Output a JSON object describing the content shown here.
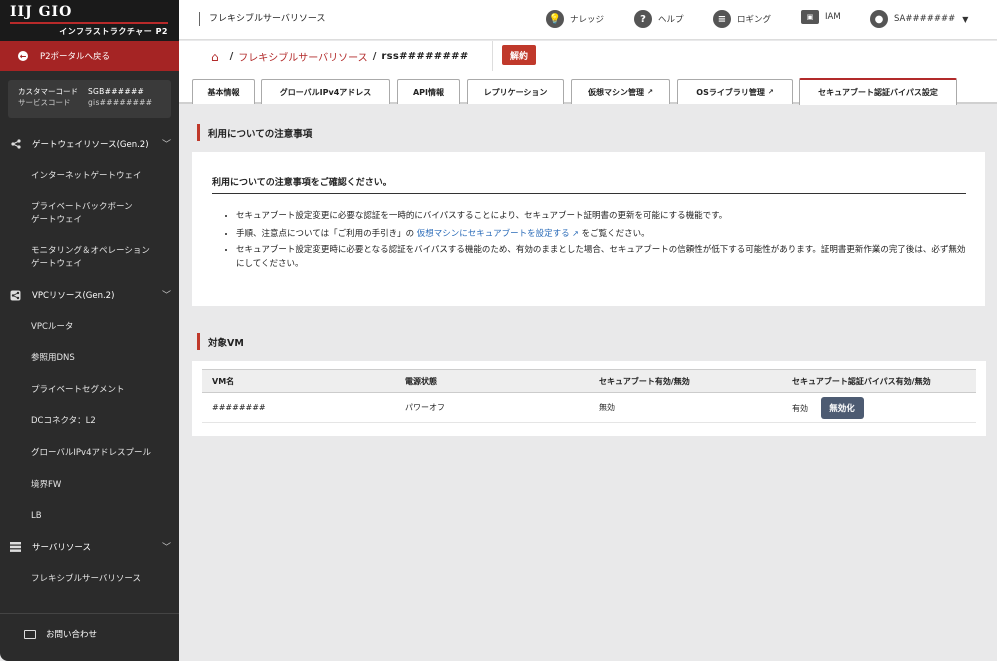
{
  "app": {
    "logo_top": "IIJ GIO",
    "logo_sub": "インフラストラクチャー P2",
    "portal_back": "P2ポータルへ戻る"
  },
  "codes": {
    "customer_label": "カスタマーコード",
    "customer_value": "SGB######",
    "service_label": "サービスコード",
    "service_value": "gis########"
  },
  "sidebar": {
    "sections": [
      {
        "label": "ゲートウェイリソース(Gen.2)",
        "icon": "share-icon"
      },
      {
        "label": "VPCリソース(Gen.2)",
        "icon": "share-square-icon"
      },
      {
        "label": "サーバリソース",
        "icon": "server-icon"
      }
    ],
    "items": [
      "インターネットゲートウェイ",
      "プライベートバックボーン\nゲートウェイ",
      "モニタリング＆オペレーション\nゲートウェイ",
      "VPCルータ",
      "参照用DNS",
      "プライベートセグメント",
      "DCコネクタ：L2",
      "グローバルIPv4アドレスプール",
      "境界FW",
      "LB",
      "フレキシブルサーバリソース"
    ],
    "contact": "お問い合わせ"
  },
  "header": {
    "title": "フレキシブルサーバリソース",
    "menu": {
      "knowledge": "ナレッジ",
      "help": "ヘルプ",
      "logging": "ロギング",
      "iam": "IAM",
      "user": "SA#######"
    }
  },
  "breadcrumb": {
    "link": "フレキシブルサーバリソース",
    "current": "rss########",
    "cancel_label": "解約"
  },
  "tabs": [
    "基本情報",
    "グローバルIPv4アドレス",
    "API情報",
    "レプリケーション",
    "仮想マシン管理",
    "OSライブラリ管理",
    "セキュアブート認証バイパス設定"
  ],
  "notice": {
    "heading": "利用についての注意事項",
    "title": "利用についての注意事項をご確認ください。",
    "item1": "セキュアブート設定変更に必要な認証を一時的にバイパスすることにより、セキュアブート証明書の更新を可能にする機能です。",
    "item2_pre": "手順、注意点については「ご利用の手引き」の",
    "item2_link": "仮想マシンにセキュアブートを設定する",
    "item2_post": "をご覧ください。",
    "item3": "セキュアブート設定変更時に必要となる認証をバイパスする機能のため、有効のままとした場合、セキュアブートの信頼性が低下する可能性があります。証明書更新作業の完了後は、必ず無効にしてください。"
  },
  "vm": {
    "heading": "対象VM",
    "columns": [
      "VM名",
      "電源状態",
      "セキュアブート有効/無効",
      "セキュアブート認証バイパス有効/無効"
    ],
    "rows": [
      {
        "name": "########",
        "power": "パワーオフ",
        "secure_boot": "無効",
        "bypass": "有効",
        "action": "無効化"
      }
    ]
  },
  "colors": {
    "accent": "#c0392b",
    "sidebar": "#2b2b2b",
    "link": "#2a6bb8",
    "button_dark": "#4d5b72"
  }
}
